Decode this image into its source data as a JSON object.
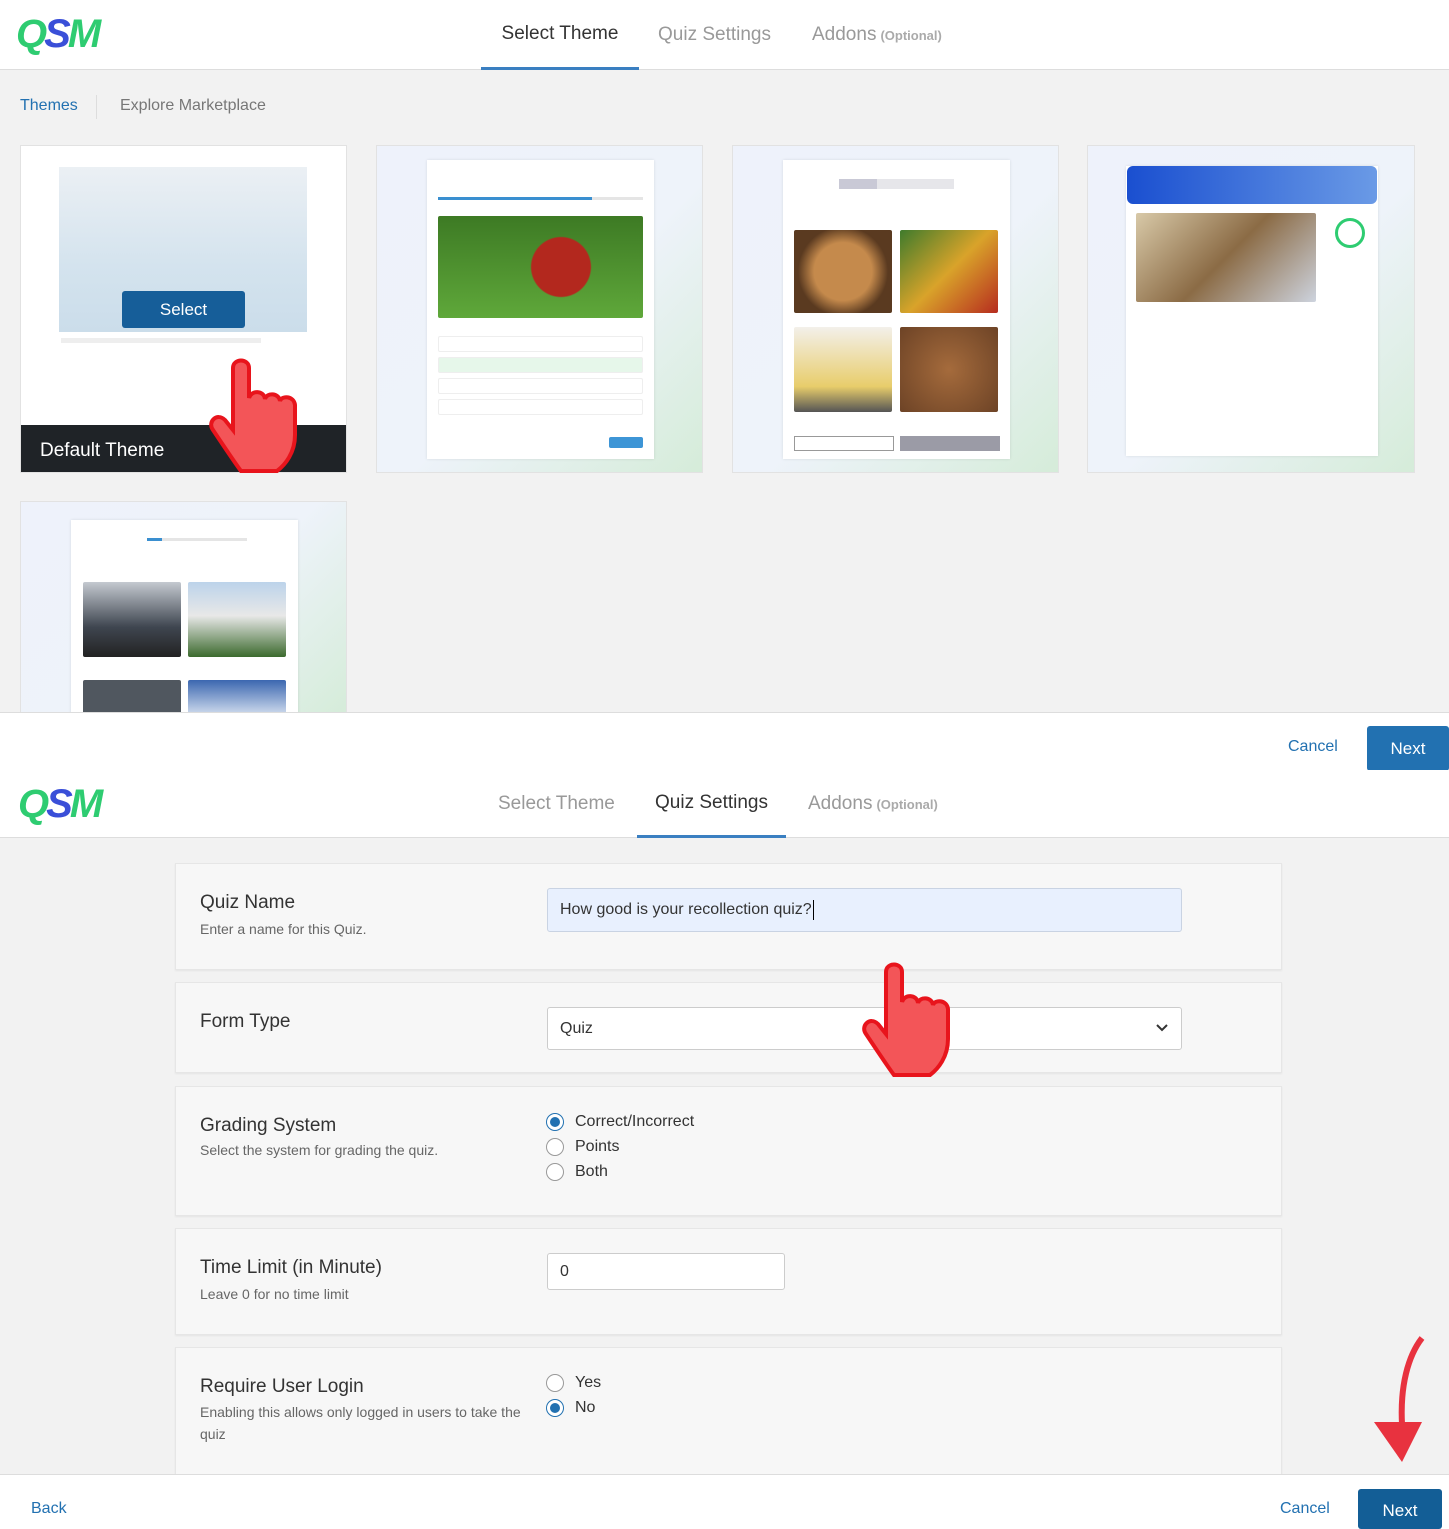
{
  "logo": {
    "text": "QSM"
  },
  "top": {
    "tabs": [
      {
        "label": "Select Theme"
      },
      {
        "label": "Quiz Settings"
      },
      {
        "label": "Addons",
        "suffix": "(Optional)"
      }
    ],
    "subnav": [
      {
        "label": "Themes"
      },
      {
        "label": "Explore Marketplace"
      }
    ],
    "default_theme": {
      "name": "Default Theme",
      "select_label": "Select"
    },
    "footer": {
      "cancel": "Cancel",
      "next": "Next"
    }
  },
  "bottom": {
    "tabs": [
      {
        "label": "Select Theme"
      },
      {
        "label": "Quiz Settings"
      },
      {
        "label": "Addons",
        "suffix": "(Optional)"
      }
    ],
    "quiz_name": {
      "label": "Quiz Name",
      "desc": "Enter a name for this Quiz.",
      "value": "How good is your recollection quiz?"
    },
    "form_type": {
      "label": "Form Type",
      "value": "Quiz"
    },
    "grading": {
      "label": "Grading System",
      "desc": "Select the system for grading the quiz.",
      "options": [
        "Correct/Incorrect",
        "Points",
        "Both"
      ],
      "selected": "Correct/Incorrect"
    },
    "time_limit": {
      "label": "Time Limit (in Minute)",
      "desc": "Leave 0 for no time limit",
      "value": "0"
    },
    "login": {
      "label": "Require User Login",
      "desc": "Enabling this allows only logged in users to take the quiz",
      "options": [
        "Yes",
        "No"
      ],
      "selected": "No"
    },
    "footer": {
      "back": "Back",
      "cancel": "Cancel",
      "next": "Next"
    }
  },
  "colors": {
    "accent": "#2271b1",
    "logo_green": "#2ecc71",
    "logo_blue": "#3a4fd8",
    "pointer_red": "#f0393f"
  }
}
